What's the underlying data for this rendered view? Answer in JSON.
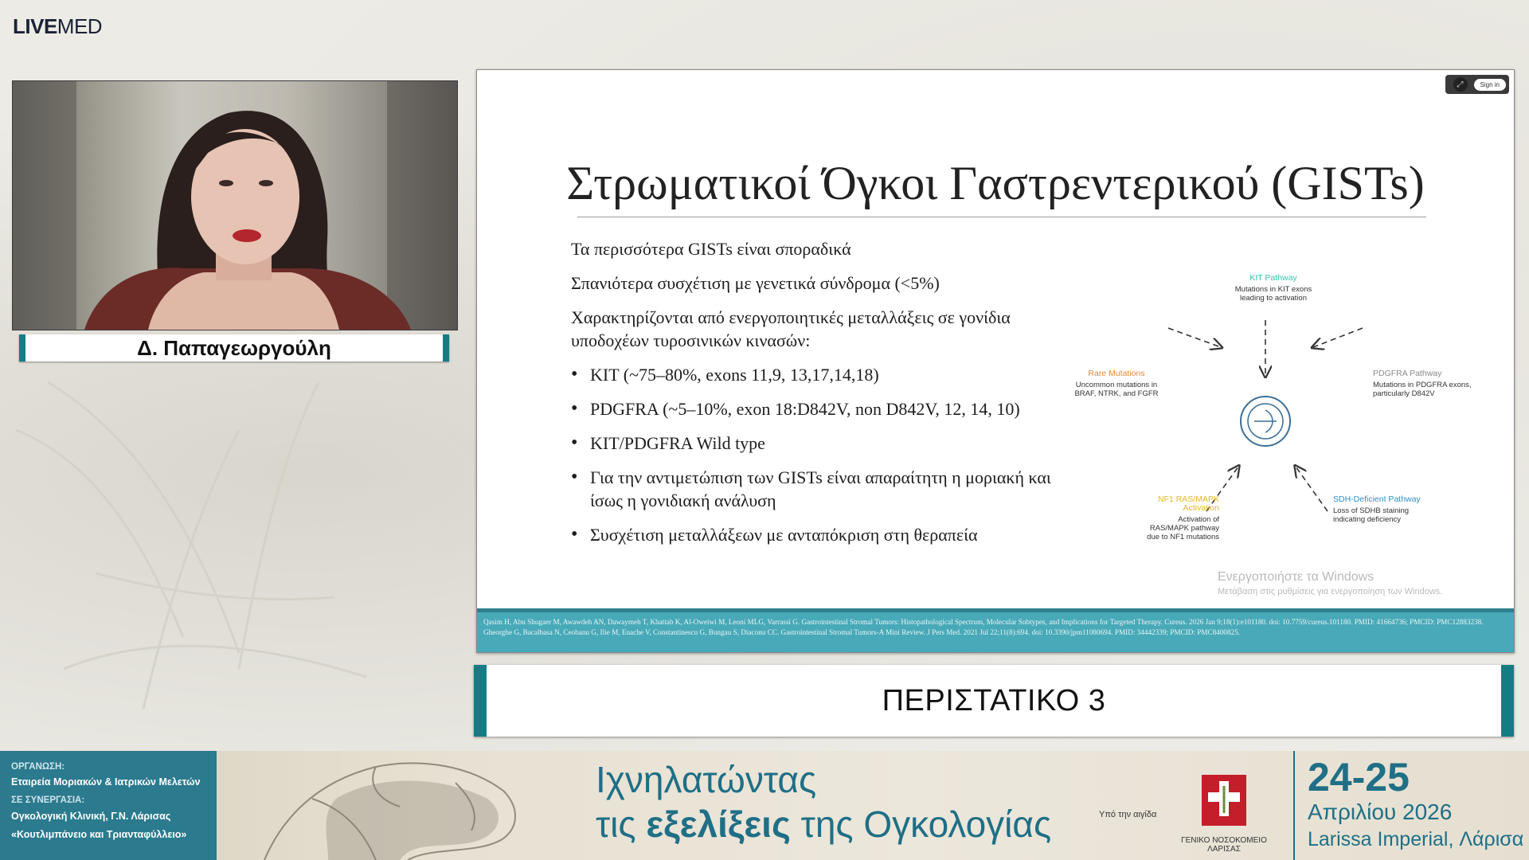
{
  "brand": {
    "part1": "LIVE",
    "part2": "MED"
  },
  "speaker": {
    "name": "Δ. Παπαγεωργούλη"
  },
  "slide": {
    "controls": {
      "expand_icon": "expand-icon",
      "signin_label": "Sign in"
    },
    "title": "Στρωματικοί Όγκοι Γαστρεντερικού (GISTs)",
    "paragraphs": [
      "Τα περισσότερα GISTs είναι σποραδικά",
      "Σπανιότερα συσχέτιση με γενετικά σύνδρομα (<5%)",
      "Χαρακτηρίζονται από ενεργοποιητικές μεταλλάξεις σε γονίδια υποδοχέων τυροσινικών κινασών:"
    ],
    "bullets": [
      "KIT (~75–80%, exons 11,9, 13,17,14,18)",
      "PDGFRA (~5–10%, exon 18:D842V, non D842V, 12, 14, 10)",
      "KIT/PDGFRA Wild type",
      "Για την αντιμετώπιση των GISTs είναι απαραίτητη η μοριακή και ίσως η γονιδιακή ανάλυση",
      "Συσχέτιση μεταλλάξεων με ανταπόκριση στη θεραπεία"
    ],
    "diagram": {
      "kit": {
        "title": "KIT Pathway",
        "desc": "Mutations in KIT exons leading to activation",
        "color": "#3bbfad"
      },
      "pdgfra": {
        "title": "PDGFRA Pathway",
        "desc": "Mutations in PDGFRA exons, particularly D842V",
        "color": "#8a8a8a"
      },
      "rare": {
        "title": "Rare Mutations",
        "desc": "Uncommon mutations in BRAF, NTRK, and FGFR",
        "color": "#e08a3a"
      },
      "nf1": {
        "title": "NF1 RAS/MAPK Activation",
        "desc": "Activation of RAS/MAPK pathway due to NF1 mutations",
        "color": "#e6b820"
      },
      "sdh": {
        "title": "SDH-Deficient Pathway",
        "desc": "Loss of SDHB staining indicating deficiency",
        "color": "#2f8fd0"
      },
      "center_icon": "gist-logo-icon"
    },
    "watermark": {
      "line1": "Ενεργοποιήστε τα Windows",
      "line2": "Μετάβαση στις ρυθμίσεις για ενεργοποίηση των Windows."
    },
    "references": [
      "Qasim H, Abu Shugaer M, Awawdeh AN, Dawaymeh T, Khattab K, Al-Oweiwi M, Leoni MLG, Varrassi G. Gastrointestinal Stromal Tumors: Histopathological Spectrum, Molecular Subtypes, and Implications for Targeted Therapy. Cureus. 2026 Jan 9;18(1):e101180. doi: 10.7759/cureus.101180. PMID: 41664736; PMCID: PMC12883238.",
      "Gheorghe G, Bacalbasa N, Ceobanu G, Ilie M, Enache V, Constantinescu G, Bungau S, Diaconu CC. Gastrointestinal Stromal Tumors-A Mini Review. J Pers Med. 2021 Jul 22;11(8):694. doi: 10.3390/jpm11080694. PMID: 34442339; PMCID: PMC8400825."
    ]
  },
  "case_label": "ΠΕΡΙΣΤΑΤΙΚΟ 3",
  "footer": {
    "org_label": "ΟΡΓΑΝΩΣΗ:",
    "org_value": "Εταιρεία Μοριακών & Ιατρικών Μελετών",
    "collab_label": "ΣΕ ΣΥΝΕΡΓΑΣΙΑ:",
    "collab_line1": "Ογκολογική Κλινική, Γ.Ν. Λάρισας",
    "collab_line2": "«Κουτλιμπάνειο και Τριανταφύλλειο»",
    "event_line1": "Ιχνηλατώντας",
    "event_line2_a": "τις",
    "event_line2_b": "εξελίξεις",
    "event_line2_c": "της Ογκολογίας",
    "aegis": "Υπό την αιγίδα",
    "hospital_name": "ΓΕΝΙΚΟ ΝΟΣΟΚΟΜΕΙΟ ΛΑΡΙΣΑΣ",
    "dates": "24-25",
    "month_year": "Απριλίου 2026",
    "venue": "Larissa Imperial, Λάρισα"
  }
}
